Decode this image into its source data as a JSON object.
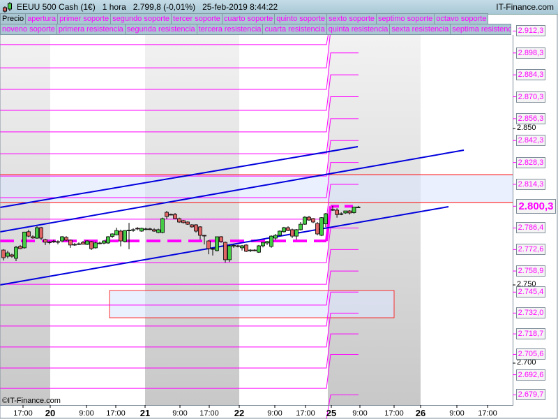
{
  "header": {
    "title": "EEUU 500 Cash (1€)   1 hora   2.799,8 (-0,01%)   25-feb-2019 8:44:22",
    "brand": "IT-Finance.com"
  },
  "legend_row1": [
    "Precio",
    "apertura",
    "primer soporte",
    "segundo soporte",
    "tercer soporte",
    "cuarto soporte",
    "quinto soporte",
    "sexto soporte",
    "septimo soporte",
    "octavo soporte"
  ],
  "legend_row2": [
    "noveno soporte",
    "primera resistencia",
    "segunda resistencia",
    "tercera resistencia",
    "cuarta resistencia",
    "quinta resistencia",
    "sexta resistencia",
    "septima resistencia"
  ],
  "copyright": "©IT-Finance.com",
  "colors": {
    "level": "#ff00ff",
    "trend": "#0000dd",
    "resistance_band": "#ff0000",
    "up": "#44cc44",
    "down": "#e06666"
  },
  "chart_data": {
    "type": "candlestick",
    "ylim": [
      2665,
      2925
    ],
    "y_ticks": [
      "2.850",
      "2.750",
      "2.700"
    ],
    "y_tick_values": [
      2850,
      2750,
      2700
    ],
    "level_labels": [
      "2.912,3",
      "2.898,3",
      "2.884,3",
      "2.870,3",
      "2.856,3",
      "2.842,3",
      "2.828,3",
      "2.814,3",
      "2.800,3",
      "2.786,4",
      "2.772,6",
      "2.758,9",
      "2.745,4",
      "2.732,0",
      "2.718,7",
      "2.705,6",
      "2.692,6",
      "2.679,7"
    ],
    "level_values": [
      2912.3,
      2898.3,
      2884.3,
      2870.3,
      2856.3,
      2842.3,
      2828.3,
      2814.3,
      2800.3,
      2786.4,
      2772.6,
      2758.9,
      2745.4,
      2732.0,
      2718.7,
      2705.6,
      2692.6,
      2679.7
    ],
    "current_price_label": "2.800,3",
    "previous_levels": [
      2903.6,
      2888.8,
      2875.0,
      2861.6,
      2847.8,
      2833.9,
      2819.6,
      2805.8,
      2792.0,
      2778.1,
      2764.3,
      2750.4,
      2737.1,
      2723.7,
      2710.3,
      2696.9,
      2683.9
    ],
    "red_lines": [
      2820.5,
      2802.7
    ],
    "x_labels": [
      {
        "t": "17:00",
        "day": false
      },
      {
        "t": "20",
        "day": true
      },
      {
        "t": "9:00",
        "day": false
      },
      {
        "t": "17:00",
        "day": false
      },
      {
        "t": "21",
        "day": true
      },
      {
        "t": "9:00",
        "day": false
      },
      {
        "t": "17:00",
        "day": false
      },
      {
        "t": "22",
        "day": true
      },
      {
        "t": "9:00",
        "day": false
      },
      {
        "t": "17:00",
        "day": false
      },
      {
        "t": "25",
        "day": true
      },
      {
        "t": "9:00",
        "day": false
      },
      {
        "t": "17:00",
        "day": false
      },
      {
        "t": "26",
        "day": true
      },
      {
        "t": "9:00",
        "day": false
      },
      {
        "t": "17:00",
        "day": false
      }
    ],
    "candles_prev": [
      [
        2772.3,
        2772.8,
        2765.7,
        2767.4
      ],
      [
        2768.3,
        2771.9,
        2767.0,
        2770.5
      ],
      [
        2769.2,
        2770.0,
        2767.4,
        2768.3
      ],
      [
        2767.0,
        2775.0,
        2765.2,
        2774.1
      ],
      [
        2774.6,
        2775.5,
        2772.8,
        2773.2
      ],
      [
        2773.7,
        2784.0,
        2773.2,
        2783.8
      ],
      [
        2784.0,
        2785.3,
        2780.4,
        2781.2
      ],
      [
        2780.8,
        2781.7,
        2779.5,
        2780.0
      ],
      [
        2779.9,
        2787.5,
        2779.5,
        2786.6
      ],
      [
        2786.6,
        2787.1,
        2778.6,
        2779.9
      ],
      [
        2779.0,
        2779.5,
        2775.5,
        2777.3
      ],
      [
        2777.2,
        2778.0,
        2776.0,
        2777.5
      ],
      [
        2777.7,
        2779.0,
        2776.8,
        2778.0
      ],
      [
        2777.7,
        2778.5,
        2776.0,
        2777.5
      ],
      [
        2778.1,
        2781.2,
        2777.2,
        2780.8
      ],
      [
        2780.4,
        2781.2,
        2778.0,
        2778.6
      ],
      [
        2778.6,
        2779.0,
        2773.7,
        2775.5
      ],
      [
        2775.9,
        2776.8,
        2775.0,
        2775.9
      ],
      [
        2776.3,
        2777.2,
        2775.5,
        2776.3
      ],
      [
        2777.2,
        2778.1,
        2775.9,
        2776.0
      ],
      [
        2775.9,
        2778.5,
        2775.5,
        2778.1
      ],
      [
        2777.7,
        2778.1,
        2772.3,
        2773.2
      ],
      [
        2773.7,
        2777.7,
        2773.2,
        2776.9
      ],
      [
        2776.8,
        2777.7,
        2776.0,
        2776.5
      ],
      [
        2776.7,
        2778.5,
        2776.0,
        2778.1
      ],
      [
        2776.8,
        2781.2,
        2776.3,
        2780.8
      ],
      [
        2781.0,
        2783.0,
        2780.0,
        2782.6
      ],
      [
        2782.0,
        2786.6,
        2781.7,
        2784.8
      ],
      [
        2784.4,
        2785.3,
        2774.6,
        2778.1
      ],
      [
        2777.7,
        2785.0,
        2777.2,
        2784.8
      ],
      [
        2784.8,
        2789.7,
        2772.8,
        2785.0
      ],
      [
        2785.3,
        2786.2,
        2784.0,
        2785.3
      ],
      [
        2786.2,
        2787.0,
        2785.0,
        2786.0
      ],
      [
        2784.4,
        2786.6,
        2784.0,
        2786.2
      ],
      [
        2785.7,
        2786.6,
        2785.0,
        2785.8
      ],
      [
        2785.8,
        2786.5,
        2785.0,
        2785.7
      ],
      [
        2785.3,
        2786.2,
        2784.0,
        2784.4
      ],
      [
        2783.5,
        2786.0,
        2783.0,
        2785.3
      ],
      [
        2783.5,
        2793.0,
        2783.0,
        2792.4
      ],
      [
        2796.4,
        2797.3,
        2792.0,
        2793.7
      ],
      [
        2795.1,
        2795.6,
        2794.6,
        2795.0
      ],
      [
        2795.1,
        2796.0,
        2792.0,
        2792.4
      ],
      [
        2792.4,
        2793.0,
        2789.7,
        2790.2
      ],
      [
        2791.1,
        2791.5,
        2789.3,
        2789.8
      ],
      [
        2790.2,
        2790.7,
        2788.4,
        2788.8
      ],
      [
        2788.4,
        2788.8,
        2786.6,
        2787.1
      ],
      [
        2788.4,
        2788.8,
        2783.5,
        2784.4
      ],
      [
        2787.1,
        2787.5,
        2779.0,
        2781.7
      ],
      [
        2781.7,
        2782.0,
        2775.9,
        2781.3
      ],
      [
        2778.1,
        2778.6,
        2769.6,
        2773.2
      ],
      [
        2773.2,
        2773.7,
        2768.8,
        2773.0
      ],
      [
        2771.9,
        2780.8,
        2771.5,
        2780.8
      ],
      [
        2780.8,
        2781.2,
        2777.0,
        2777.7
      ],
      [
        2777.2,
        2777.7,
        2764.3,
        2766.1
      ],
      [
        2766.1,
        2775.5,
        2764.7,
        2775.0
      ],
      [
        2775.0,
        2775.9,
        2773.7,
        2775.3
      ],
      [
        2775.0,
        2775.5,
        2774.0,
        2774.8
      ],
      [
        2773.7,
        2775.5,
        2772.0,
        2775.0
      ],
      [
        2775.5,
        2776.0,
        2771.0,
        2771.5
      ],
      [
        2772.0,
        2772.8,
        2771.0,
        2772.3
      ],
      [
        2772.3,
        2772.8,
        2771.5,
        2772.0
      ],
      [
        2770.9,
        2775.5,
        2770.5,
        2775.0
      ],
      [
        2775.0,
        2777.2,
        2774.0,
        2777.2
      ],
      [
        2776.8,
        2778.1,
        2775.5,
        2777.7
      ],
      [
        2774.6,
        2781.7,
        2773.7,
        2781.2
      ],
      [
        2779.9,
        2782.6,
        2778.6,
        2781.7
      ],
      [
        2781.7,
        2784.8,
        2781.2,
        2784.4
      ],
      [
        2784.0,
        2787.1,
        2783.5,
        2786.6
      ],
      [
        2786.6,
        2787.5,
        2784.4,
        2784.8
      ],
      [
        2785.3,
        2786.0,
        2779.9,
        2781.2
      ],
      [
        2781.2,
        2785.7,
        2779.0,
        2785.3
      ],
      [
        2785.3,
        2790.2,
        2784.8,
        2788.8
      ],
      [
        2788.8,
        2794.0,
        2788.4,
        2793.3
      ],
      [
        2793.3,
        2794.2,
        2791.0,
        2791.5
      ],
      [
        2792.4,
        2792.8,
        2789.5,
        2790.2
      ],
      [
        2789.3,
        2790.2,
        2781.7,
        2782.6
      ],
      [
        2781.7,
        2793.3,
        2781.2,
        2793.0
      ],
      [
        2789.0,
        2796.0,
        2787.0,
        2795.5
      ]
    ],
    "candles_today": [
      [
        2798.2,
        2800.5,
        2797.3,
        2797.8
      ],
      [
        2797.8,
        2799.0,
        2793.0,
        2795.0
      ],
      [
        2795.5,
        2796.4,
        2794.6,
        2795.5
      ],
      [
        2796.0,
        2797.3,
        2795.5,
        2797.3
      ],
      [
        2797.3,
        2797.8,
        2795.0,
        2796.0
      ],
      [
        2796.2,
        2800.0,
        2795.5,
        2799.8
      ],
      [
        2799.8,
        2800.5,
        2799.3,
        2799.8
      ]
    ]
  }
}
